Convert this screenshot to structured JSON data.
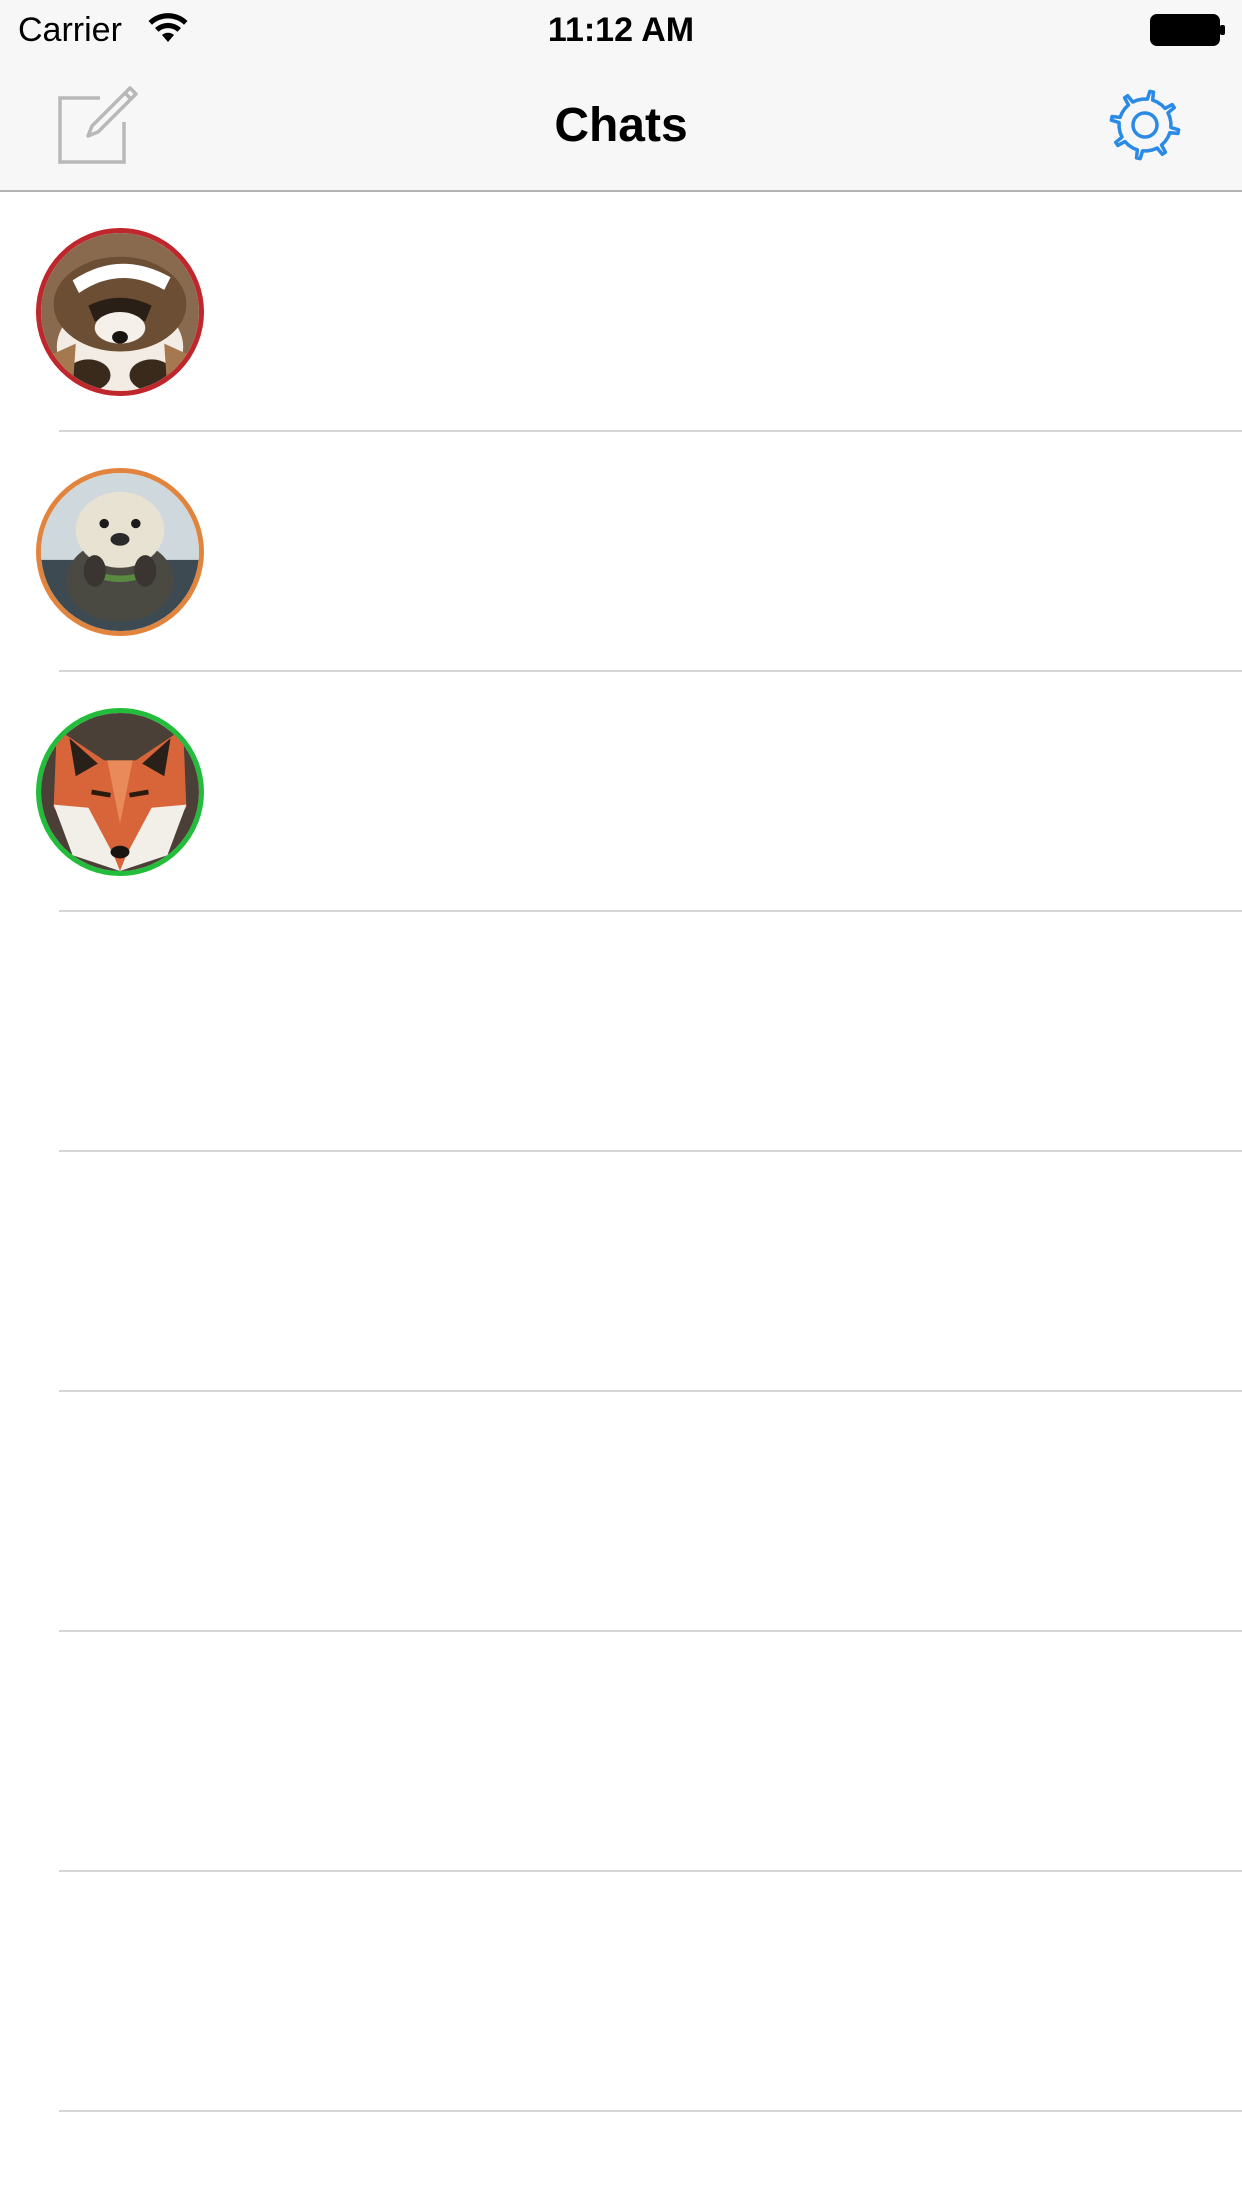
{
  "status_bar": {
    "carrier": "Carrier",
    "time": "11:12 AM",
    "wifi_icon": "wifi-icon",
    "battery_icon": "battery-full-icon"
  },
  "nav": {
    "title": "Chats",
    "compose_icon": "compose-icon",
    "settings_icon": "gear-icon",
    "accent_color": "#2a8ae6",
    "compose_color": "#b8b8b8"
  },
  "chats": [
    {
      "avatar": "badger",
      "ring_color": "#c0272d"
    },
    {
      "avatar": "otter",
      "ring_color": "#e0843e"
    },
    {
      "avatar": "fox",
      "ring_color": "#22bd3b"
    },
    {
      "avatar": null
    },
    {
      "avatar": null
    },
    {
      "avatar": null
    },
    {
      "avatar": null
    },
    {
      "avatar": null
    }
  ],
  "colors": {
    "nav_background": "#f7f7f7",
    "separator": "#d6d6d6"
  }
}
